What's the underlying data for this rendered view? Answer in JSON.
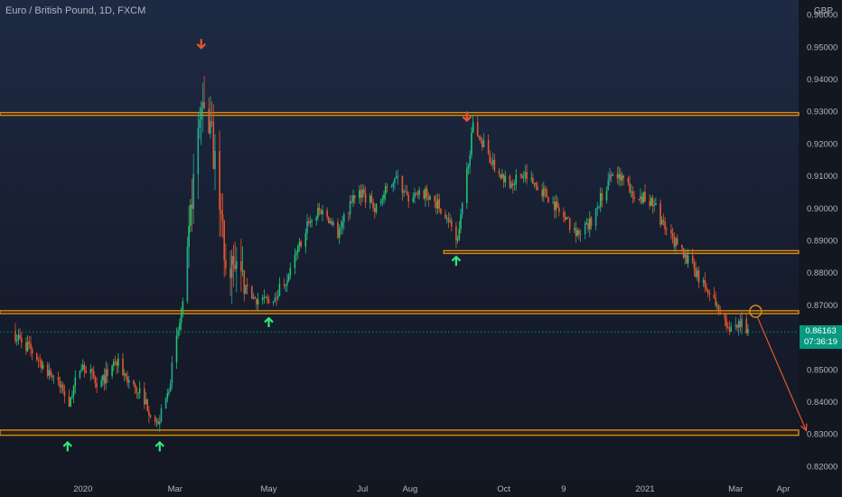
{
  "chart_data": {
    "type": "candlestick",
    "title": "Euro / British Pound, 1D, FXCM",
    "currency": "GBP",
    "last_price": "0.86163",
    "countdown": "07:36:19",
    "y_ticks": [
      0.82,
      0.83,
      0.84,
      0.85,
      0.86,
      0.87,
      0.88,
      0.89,
      0.9,
      0.91,
      0.92,
      0.93,
      0.94,
      0.95,
      0.96
    ],
    "y_tick_labels": [
      "0.82000",
      "0.83000",
      "0.84000",
      "0.85000",
      "0.86000",
      "0.87000",
      "0.88000",
      "0.89000",
      "0.90000",
      "0.91000",
      "0.92000",
      "0.93000",
      "0.94000",
      "0.95000",
      "0.96000"
    ],
    "ylim": [
      0.8155,
      0.9645
    ],
    "x_labels": [
      {
        "label": "2020",
        "date": "2020-01-01"
      },
      {
        "label": "Mar",
        "date": "2020-03-01"
      },
      {
        "label": "May",
        "date": "2020-05-01"
      },
      {
        "label": "Jul",
        "date": "2020-07-01"
      },
      {
        "label": "Aug",
        "date": "2020-08-01"
      },
      {
        "label": "Oct",
        "date": "2020-10-01"
      },
      {
        "label": "9",
        "date": "2020-11-09"
      },
      {
        "label": "2021",
        "date": "2021-01-01"
      },
      {
        "label": "Mar",
        "date": "2021-03-01"
      },
      {
        "label": "Apr",
        "date": "2021-04-01"
      }
    ],
    "price_path": [
      [
        "2019-11-15",
        0.862
      ],
      [
        "2019-11-28",
        0.856
      ],
      [
        "2019-12-12",
        0.848
      ],
      [
        "2019-12-23",
        0.84
      ],
      [
        "2019-12-31",
        0.852
      ],
      [
        "2020-01-12",
        0.845
      ],
      [
        "2020-01-22",
        0.853
      ],
      [
        "2020-02-02",
        0.845
      ],
      [
        "2020-02-10",
        0.841
      ],
      [
        "2020-02-18",
        0.832
      ],
      [
        "2020-02-25",
        0.842
      ],
      [
        "2020-03-03",
        0.862
      ],
      [
        "2020-03-08",
        0.874
      ],
      [
        "2020-03-12",
        0.905
      ],
      [
        "2020-03-16",
        0.92
      ],
      [
        "2020-03-19",
        0.935
      ],
      [
        "2020-03-23",
        0.928
      ],
      [
        "2020-03-28",
        0.91
      ],
      [
        "2020-04-03",
        0.885
      ],
      [
        "2020-04-12",
        0.876
      ],
      [
        "2020-04-22",
        0.872
      ],
      [
        "2020-05-01",
        0.871
      ],
      [
        "2020-05-08",
        0.875
      ],
      [
        "2020-05-15",
        0.88
      ],
      [
        "2020-05-25",
        0.894
      ],
      [
        "2020-06-05",
        0.9
      ],
      [
        "2020-06-15",
        0.892
      ],
      [
        "2020-06-28",
        0.906
      ],
      [
        "2020-07-10",
        0.9
      ],
      [
        "2020-07-22",
        0.91
      ],
      [
        "2020-08-01",
        0.902
      ],
      [
        "2020-08-12",
        0.905
      ],
      [
        "2020-08-25",
        0.898
      ],
      [
        "2020-09-01",
        0.889
      ],
      [
        "2020-09-04",
        0.9
      ],
      [
        "2020-09-08",
        0.915
      ],
      [
        "2020-09-11",
        0.925
      ],
      [
        "2020-09-18",
        0.92
      ],
      [
        "2020-09-25",
        0.912
      ],
      [
        "2020-10-05",
        0.908
      ],
      [
        "2020-10-15",
        0.91
      ],
      [
        "2020-10-25",
        0.906
      ],
      [
        "2020-11-05",
        0.9
      ],
      [
        "2020-11-15",
        0.893
      ],
      [
        "2020-11-25",
        0.894
      ],
      [
        "2020-12-03",
        0.903
      ],
      [
        "2020-12-10",
        0.91
      ],
      [
        "2020-12-18",
        0.909
      ],
      [
        "2020-12-24",
        0.905
      ],
      [
        "2021-01-01",
        0.903
      ],
      [
        "2021-01-08",
        0.9
      ],
      [
        "2021-01-15",
        0.892
      ],
      [
        "2021-01-25",
        0.887
      ],
      [
        "2021-02-05",
        0.878
      ],
      [
        "2021-02-15",
        0.872
      ],
      [
        "2021-02-20",
        0.866
      ],
      [
        "2021-02-25",
        0.862
      ],
      [
        "2021-03-01",
        0.864
      ],
      [
        "2021-03-05",
        0.864
      ],
      [
        "2021-03-09",
        0.8616
      ]
    ],
    "support_resistance_zones": [
      [
        0.929,
        0.9296
      ],
      [
        0.8862,
        0.8868
      ],
      [
        0.8673,
        0.8682
      ],
      [
        0.8296,
        0.8312
      ]
    ],
    "short_zone_start": "2020-08-23",
    "projection": {
      "from": [
        "2021-03-14",
        0.868
      ],
      "to": [
        "2021-04-16",
        0.831
      ]
    },
    "pivot_markers": [
      {
        "type": "down",
        "date": "2020-03-18",
        "price": 0.951
      },
      {
        "type": "down",
        "date": "2020-09-07",
        "price": 0.9285
      },
      {
        "type": "up",
        "date": "2019-12-22",
        "price": 0.826
      },
      {
        "type": "up",
        "date": "2020-02-20",
        "price": 0.826
      },
      {
        "type": "up",
        "date": "2020-05-01",
        "price": 0.8645
      },
      {
        "type": "up",
        "date": "2020-08-31",
        "price": 0.8835
      }
    ],
    "colors": {
      "background": "#131722",
      "bull": "#26a69a",
      "bull_bright": "#22c56e",
      "bear": "#e4572e",
      "zone": "#d98a1b",
      "zone_fill": "#2a2416",
      "projection": "#e4572e",
      "marker_up": "#2ee87a",
      "marker_down": "#e4572e",
      "axis_text": "#b2b5be",
      "price_badge": "#089981"
    }
  }
}
